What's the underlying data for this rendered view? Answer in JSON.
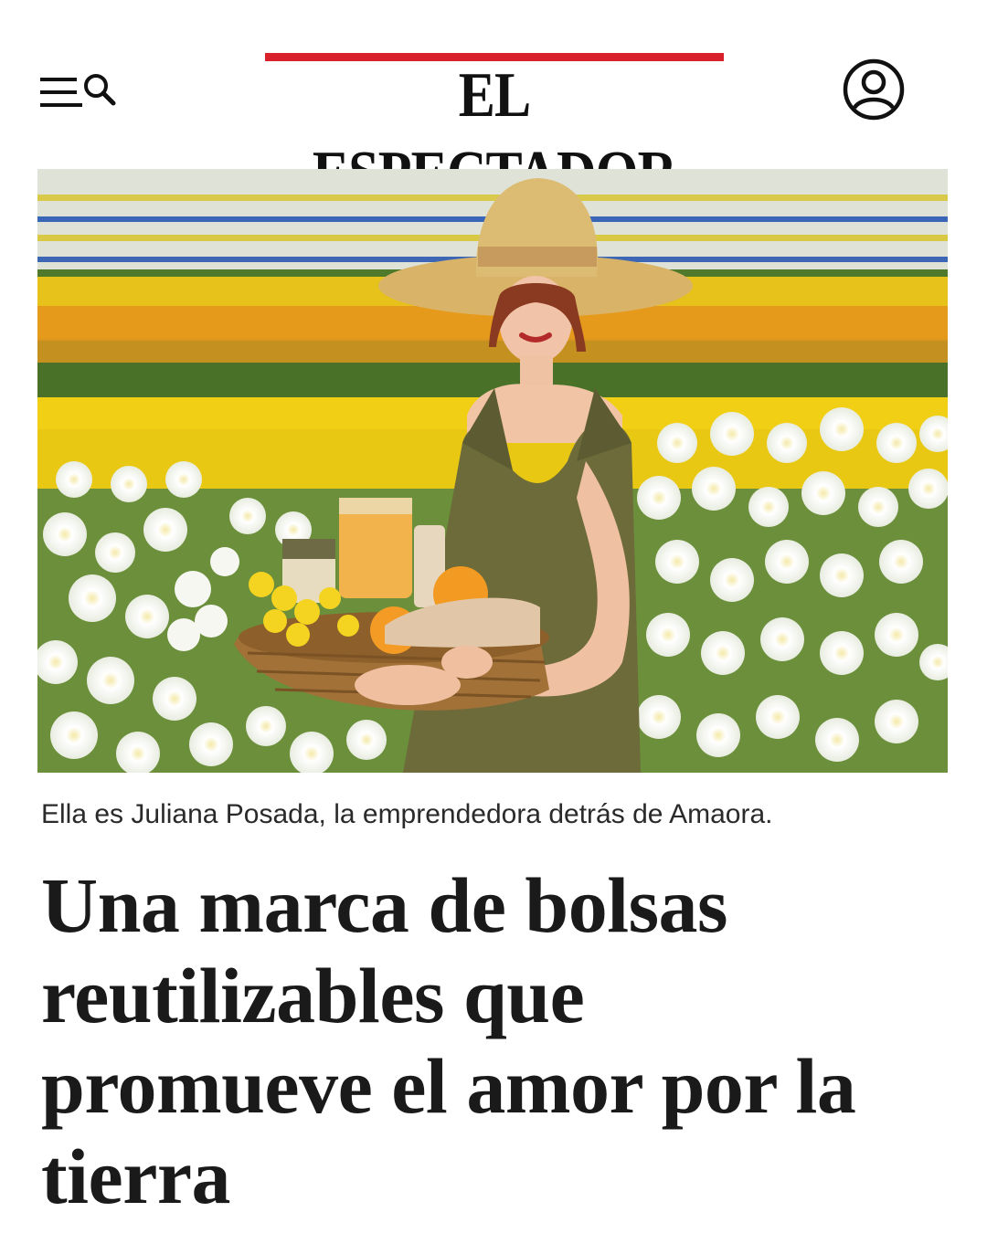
{
  "header": {
    "logo_text": "EL ESPECTADOR",
    "menu_icon": "menu-search-icon",
    "user_icon": "user-account-icon",
    "accent_color": "#d8212b"
  },
  "hero": {
    "image_description": "",
    "caption": "Ella es Juliana Posada, la emprendedora detrás de Amaora."
  },
  "article": {
    "headline_lines": [
      "Una marca de bolsas",
      "reutilizables que",
      "promueve el amor por la",
      "tierra"
    ]
  }
}
